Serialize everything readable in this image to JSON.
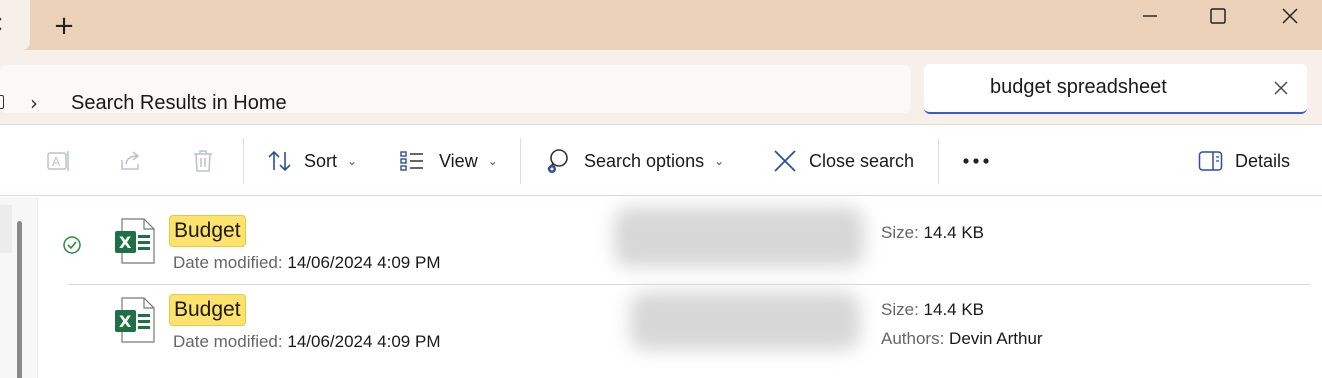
{
  "titlebar": {
    "tab_close_glyph": "✕",
    "new_tab_glyph": "+"
  },
  "address": {
    "chevron": "›",
    "breadcrumb": "Search Results in Home"
  },
  "search": {
    "value": "budget spreadsheet"
  },
  "toolbar": {
    "sort_label": "Sort",
    "view_label": "View",
    "search_options_label": "Search options",
    "close_search_label": "Close search",
    "details_label": "Details",
    "caret": "⌄"
  },
  "files": [
    {
      "name": "Budget",
      "date_key": "Date modified:",
      "date_value": "14/06/2024 4:09 PM",
      "size_key": "Size:",
      "size_value": "14.4 KB",
      "synced": true
    },
    {
      "name": "Budget",
      "date_key": "Date modified:",
      "date_value": "14/06/2024 4:09 PM",
      "size_key": "Size:",
      "size_value": "14.4 KB",
      "authors_key": "Authors:",
      "authors_value": "Devin Arthur"
    }
  ],
  "colors": {
    "titlebar": "#ecd2b8",
    "accent": "#3b5bc9",
    "highlight": "#fde26b",
    "excel_green": "#1e7145"
  }
}
